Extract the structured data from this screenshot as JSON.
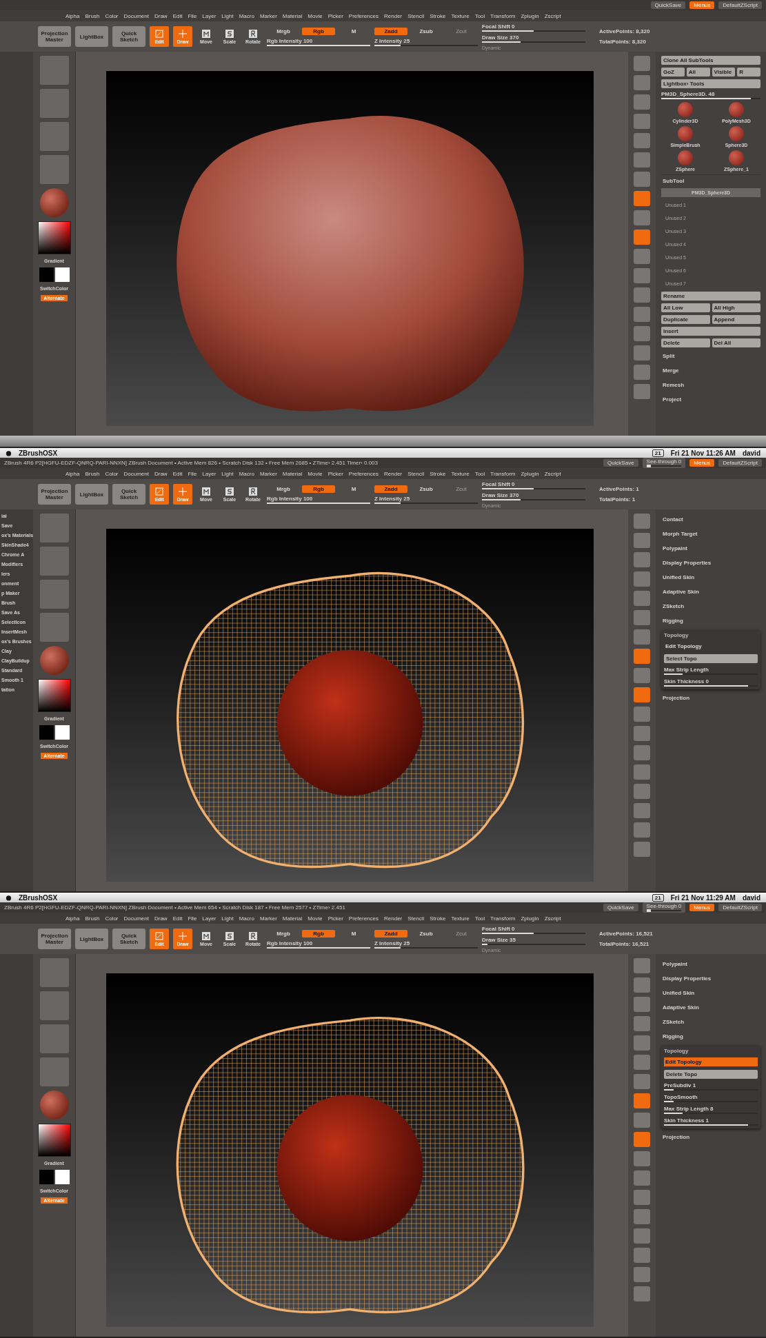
{
  "screens": [
    {
      "mesh": {
        "kind": "solid"
      },
      "top_right": {
        "quicksave": "QuickSave",
        "menus": "Menus",
        "script": "DefaultZScript"
      },
      "menus": [
        "Alpha",
        "Brush",
        "Color",
        "Document",
        "Draw",
        "Edit",
        "File",
        "Layer",
        "Light",
        "Macro",
        "Marker",
        "Material",
        "Movie",
        "Picker",
        "Preferences",
        "Render",
        "Stencil",
        "Stroke",
        "Texture",
        "Tool",
        "Transform",
        "Zplugin",
        "Zscript"
      ],
      "toolbar": {
        "big": [
          "Projection Master",
          "LightBox",
          "Quick Sketch"
        ],
        "modes": [
          {
            "label": "Edit",
            "kind": "edit",
            "selected": true
          },
          {
            "label": "Draw",
            "kind": "draw",
            "selected": true
          },
          {
            "label": "Move",
            "kind": "move",
            "selected": false
          },
          {
            "label": "Scale",
            "kind": "scale",
            "selected": false
          },
          {
            "label": "Rotate",
            "kind": "rotate",
            "selected": false
          }
        ],
        "columns": [
          {
            "toggles": [
              {
                "label": "Mrgb",
                "selected": false,
                "disabled": false
              },
              {
                "label": "Rgb",
                "selected": true,
                "disabled": false
              },
              {
                "label": "M",
                "selected": false,
                "disabled": false
              }
            ],
            "sliders": [
              {
                "label": "Rgb Intensity 100",
                "level": 1
              }
            ]
          },
          {
            "toggles": [
              {
                "label": "Zadd",
                "selected": true,
                "disabled": false
              },
              {
                "label": "Zsub",
                "selected": false,
                "disabled": false
              },
              {
                "label": "Zcut",
                "selected": false,
                "disabled": true
              }
            ],
            "sliders": [
              {
                "label": "Z Intensity 25",
                "level": 0.25
              }
            ]
          },
          {
            "sliders": [
              {
                "label": "Focal Shift 0",
                "level": 0.5
              },
              {
                "label": "Draw Size 370",
                "level": 0.37
              }
            ],
            "extra": "Dynamic"
          }
        ],
        "points": [
          "ActivePoints: 8,320",
          "TotalPoints: 8,320"
        ]
      },
      "left_tray": {
        "gradient": "Gradient",
        "switch": "SwitchColor",
        "alternate": "Alternate"
      },
      "shelf": [
        {
          "selected": false
        },
        {
          "selected": false
        },
        {
          "selected": false
        },
        {
          "selected": false
        },
        {
          "selected": false
        },
        {
          "selected": false
        },
        {
          "selected": false
        },
        {
          "selected": true
        },
        {
          "selected": false
        },
        {
          "selected": true
        },
        {
          "selected": false
        },
        {
          "selected": false
        },
        {
          "selected": false
        },
        {
          "selected": false
        },
        {
          "selected": false
        },
        {
          "selected": false
        },
        {
          "selected": false
        },
        {
          "selected": false
        }
      ],
      "right_panel": [
        {
          "kind": "buttons",
          "labels": [
            "Clone All SubTools"
          ]
        },
        {
          "kind": "buttons",
          "labels": [
            "GoZ",
            "All",
            "Visible",
            "R"
          ]
        },
        {
          "kind": "buttons",
          "labels": [
            "Lightbox› Tools"
          ]
        },
        {
          "kind": "slider",
          "label": "PM3D_Sphere3D. 48",
          "level": 0.9
        },
        {
          "kind": "tools",
          "labels": [
            "Cylinder3D",
            "PolyMesh3D",
            "SimpleBrush",
            "Sphere3D",
            "ZSphere",
            "ZSphere_1"
          ]
        },
        {
          "kind": "header",
          "label": "SubTool"
        },
        {
          "kind": "subtool",
          "label": "PM3D_Sphere3D"
        },
        {
          "kind": "slots",
          "labels": [
            "Unused 1",
            "Unused 2",
            "Unused 3",
            "Unused 4",
            "Unused 5",
            "Unused 6",
            "Unused 7"
          ]
        },
        {
          "kind": "buttons",
          "labels": [
            "Rename"
          ]
        },
        {
          "kind": "buttons",
          "labels": [
            "All Low",
            "All High"
          ]
        },
        {
          "kind": "buttons",
          "labels": [
            "Duplicate",
            "Append"
          ]
        },
        {
          "kind": "buttons",
          "labels": [
            "Insert"
          ]
        },
        {
          "kind": "buttons",
          "labels": [
            "Delete",
            "Del All"
          ]
        },
        {
          "kind": "item",
          "label": "Split"
        },
        {
          "kind": "item",
          "label": "Merge"
        },
        {
          "kind": "item",
          "label": "Remesh"
        },
        {
          "kind": "item",
          "label": "Project"
        }
      ]
    },
    {
      "mesh": {
        "kind": "wire"
      },
      "menubar": {
        "app": "ZBrushOSX",
        "badge": "21",
        "clock": "Fri 21 Nov 11:26 AM",
        "user": "david"
      },
      "title": "ZBrush 4R6 P2[HGFU-EDZF-QNRQ-PARI-NNXN]     ZBrush Document     • Active Mem 826 • Scratch Disk 132 • Free Mem 2685 • ZTime› 2.451 Timer› 0.003",
      "top_right": {
        "quicksave": "QuickSave",
        "see_through": {
          "label": "See-through 0",
          "level": 0
        },
        "menus": "Menus",
        "script": "DefaultZScript"
      },
      "menus": [
        "Alpha",
        "Brush",
        "Color",
        "Document",
        "Draw",
        "Edit",
        "File",
        "Layer",
        "Light",
        "Macro",
        "Marker",
        "Material",
        "Movie",
        "Picker",
        "Preferences",
        "Render",
        "Stencil",
        "Stroke",
        "Texture",
        "Tool",
        "Transform",
        "Zplugin",
        "Zscript"
      ],
      "toolbar": {
        "big": [
          "Projection Master",
          "LightBox",
          "Quick Sketch"
        ],
        "modes": [
          {
            "label": "Edit",
            "kind": "edit",
            "selected": true
          },
          {
            "label": "Draw",
            "kind": "draw",
            "selected": true
          },
          {
            "label": "Move",
            "kind": "move",
            "selected": false
          },
          {
            "label": "Scale",
            "kind": "scale",
            "selected": false
          },
          {
            "label": "Rotate",
            "kind": "rotate",
            "selected": false
          }
        ],
        "columns": [
          {
            "toggles": [
              {
                "label": "Mrgb",
                "selected": false,
                "disabled": false
              },
              {
                "label": "Rgb",
                "selected": true,
                "disabled": false
              },
              {
                "label": "M",
                "selected": false,
                "disabled": false
              }
            ],
            "sliders": [
              {
                "label": "Rgb Intensity 100",
                "level": 1
              }
            ]
          },
          {
            "toggles": [
              {
                "label": "Zadd",
                "selected": true,
                "disabled": false
              },
              {
                "label": "Zsub",
                "selected": false,
                "disabled": false
              },
              {
                "label": "Zcut",
                "selected": false,
                "disabled": true
              }
            ],
            "sliders": [
              {
                "label": "Z Intensity 25",
                "level": 0.25
              }
            ]
          },
          {
            "sliders": [
              {
                "label": "Focal Shift 0",
                "level": 0.5
              },
              {
                "label": "Draw Size 370",
                "level": 0.37
              }
            ],
            "extra": "Dynamic"
          }
        ],
        "points": [
          "ActivePoints: 1",
          "TotalPoints: 1"
        ]
      },
      "left_edge": [
        "ial",
        "Save",
        "ox's Materials",
        "SkinShade4",
        "Chrome A",
        "Modifiers",
        "iers",
        "onment",
        "p Maker",
        "Brush",
        "Save As",
        "SelectIcon",
        "InsertMesh",
        "ox's Brushes",
        "Clay",
        "ClayBuildup",
        "Standard",
        "Smooth 1",
        "tation"
      ],
      "left_tray": {
        "gradient": "Gradient",
        "switch": "SwitchColor",
        "alternate": "Alternate"
      },
      "shelf": [
        {
          "selected": false
        },
        {
          "selected": false
        },
        {
          "selected": false
        },
        {
          "selected": false
        },
        {
          "selected": false
        },
        {
          "selected": false
        },
        {
          "selected": false
        },
        {
          "selected": true
        },
        {
          "selected": false
        },
        {
          "selected": true
        },
        {
          "selected": false
        },
        {
          "selected": false
        },
        {
          "selected": false
        },
        {
          "selected": false
        },
        {
          "selected": false
        },
        {
          "selected": false
        },
        {
          "selected": false
        },
        {
          "selected": false
        }
      ],
      "right_panel": [
        {
          "kind": "item",
          "label": "Contact"
        },
        {
          "kind": "item",
          "label": "Morph Target"
        },
        {
          "kind": "item",
          "label": "Polypaint"
        },
        {
          "kind": "item",
          "label": "Display Properties"
        },
        {
          "kind": "item",
          "label": "Unified Skin"
        },
        {
          "kind": "item",
          "label": "Adaptive Skin"
        },
        {
          "kind": "item",
          "label": "ZSketch"
        },
        {
          "kind": "item",
          "label": "Rigging"
        },
        {
          "kind": "group",
          "label": "Topology",
          "items": [
            {
              "kind": "toggle",
              "label": "Edit Topology",
              "on": false
            },
            {
              "kind": "buttons",
              "labels": [
                "Select Topo"
              ]
            },
            {
              "kind": "slider",
              "label": "Max Strip Length",
              "level": 0.2
            },
            {
              "kind": "slider",
              "label": "Skin Thickness 0",
              "level": 0.9
            }
          ]
        },
        {
          "kind": "item",
          "label": "Projection"
        }
      ]
    },
    {
      "mesh": {
        "kind": "wire"
      },
      "menubar": {
        "app": "ZBrushOSX",
        "badge": "21",
        "clock": "Fri 21 Nov 11:29 AM",
        "user": "david"
      },
      "title": "ZBrush 4R6 P2[HGFU-EDZF-QNRQ-PARI-NNXN]     ZBrush Document     • Active Mem 654 • Scratch Disk 187 • Free Mem 2577 • ZTime› 2.451",
      "top_right": {
        "quicksave": "QuickSave",
        "see_through": {
          "label": "See-through 0",
          "level": 0
        },
        "menus": "Menus",
        "script": "DefaultZScript"
      },
      "menus": [
        "Alpha",
        "Brush",
        "Color",
        "Document",
        "Draw",
        "Edit",
        "File",
        "Layer",
        "Light",
        "Macro",
        "Marker",
        "Material",
        "Movie",
        "Picker",
        "Preferences",
        "Render",
        "Stencil",
        "Stroke",
        "Texture",
        "Tool",
        "Transform",
        "Zplugin",
        "Zscript"
      ],
      "toolbar": {
        "big": [
          "Projection Master",
          "LightBox",
          "Quick Sketch"
        ],
        "modes": [
          {
            "label": "Edit",
            "kind": "edit",
            "selected": true
          },
          {
            "label": "Draw",
            "kind": "draw",
            "selected": true
          },
          {
            "label": "Move",
            "kind": "move",
            "selected": false
          },
          {
            "label": "Scale",
            "kind": "scale",
            "selected": false
          },
          {
            "label": "Rotate",
            "kind": "rotate",
            "selected": false
          }
        ],
        "columns": [
          {
            "toggles": [
              {
                "label": "Mrgb",
                "selected": false,
                "disabled": false
              },
              {
                "label": "Rgb",
                "selected": true,
                "disabled": false
              },
              {
                "label": "M",
                "selected": false,
                "disabled": false
              }
            ],
            "sliders": [
              {
                "label": "Rgb Intensity 100",
                "level": 1
              }
            ]
          },
          {
            "toggles": [
              {
                "label": "Zadd",
                "selected": true,
                "disabled": false
              },
              {
                "label": "Zsub",
                "selected": false,
                "disabled": false
              },
              {
                "label": "Zcut",
                "selected": false,
                "disabled": true
              }
            ],
            "sliders": [
              {
                "label": "Z Intensity 25",
                "level": 0.25
              }
            ]
          },
          {
            "sliders": [
              {
                "label": "Focal Shift 0",
                "level": 0.5
              },
              {
                "label": "Draw Size 35",
                "level": 0.05
              }
            ],
            "extra": "Dynamic"
          }
        ],
        "points": [
          "ActivePoints: 16,521",
          "TotalPoints: 16,521"
        ]
      },
      "left_tray": {
        "gradient": "Gradient",
        "switch": "SwitchColor",
        "alternate": "Alternate"
      },
      "shelf": [
        {
          "selected": false
        },
        {
          "selected": false
        },
        {
          "selected": false
        },
        {
          "selected": false
        },
        {
          "selected": false
        },
        {
          "selected": false
        },
        {
          "selected": false
        },
        {
          "selected": true
        },
        {
          "selected": false
        },
        {
          "selected": true
        },
        {
          "selected": false
        },
        {
          "selected": false
        },
        {
          "selected": false
        },
        {
          "selected": false
        },
        {
          "selected": false
        },
        {
          "selected": false
        },
        {
          "selected": false
        },
        {
          "selected": false
        }
      ],
      "right_panel": [
        {
          "kind": "item",
          "label": "Polypaint"
        },
        {
          "kind": "item",
          "label": "Display Properties"
        },
        {
          "kind": "item",
          "label": "Unified Skin"
        },
        {
          "kind": "item",
          "label": "Adaptive Skin"
        },
        {
          "kind": "item",
          "label": "ZSketch"
        },
        {
          "kind": "item",
          "label": "Rigging"
        },
        {
          "kind": "group",
          "label": "Topology",
          "items": [
            {
              "kind": "toggle",
              "label": "Edit Topology",
              "on": true
            },
            {
              "kind": "buttons",
              "labels": [
                "Delete Topo"
              ]
            },
            {
              "kind": "slider",
              "label": "PreSubdiv 1",
              "level": 0.1
            },
            {
              "kind": "slider",
              "label": "TopoSmooth",
              "level": 0.1
            },
            {
              "kind": "slider",
              "label": "Max Strip Length 8",
              "level": 0.2
            },
            {
              "kind": "slider",
              "label": "Skin Thickness 1",
              "level": 0.9
            }
          ]
        },
        {
          "kind": "item",
          "label": "Projection"
        }
      ]
    }
  ]
}
